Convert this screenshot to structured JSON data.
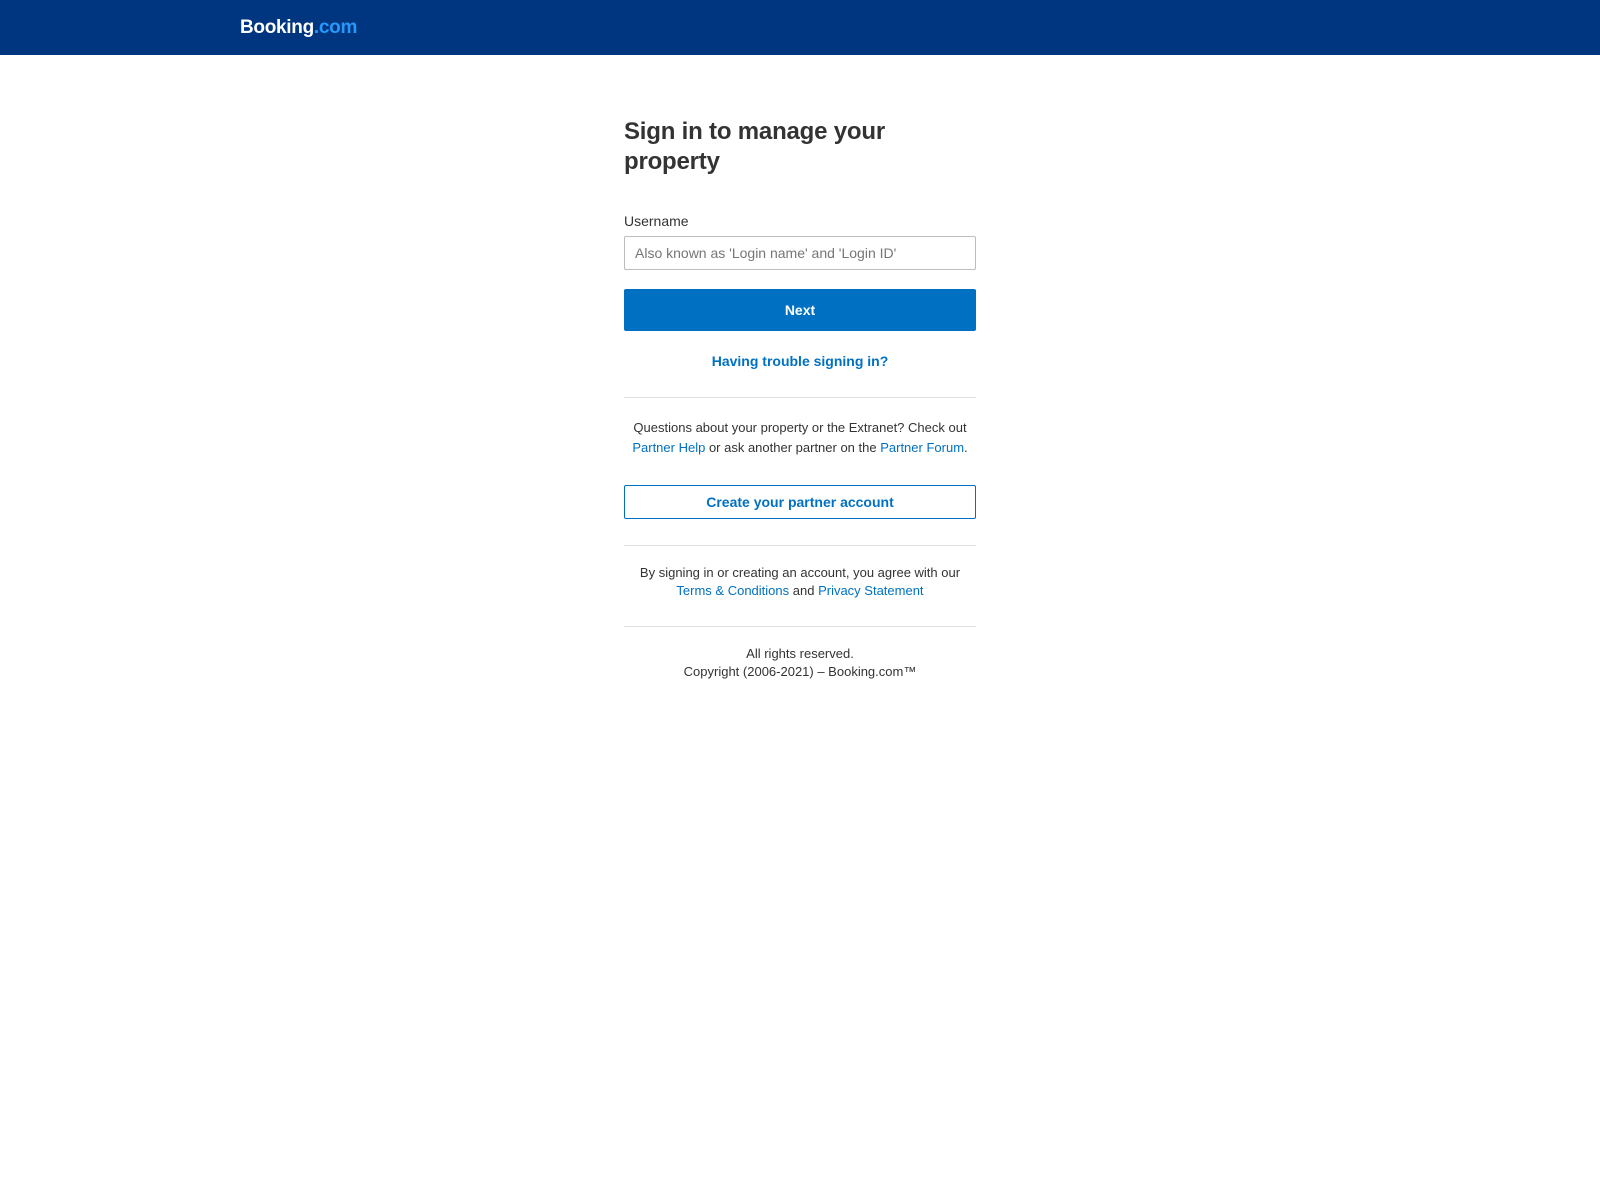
{
  "header": {
    "logo_main": "Booking",
    "logo_tld": ".com",
    "bg_color": "#003580",
    "tld_color": "#2699fb"
  },
  "main": {
    "title": "Sign in to manage your property",
    "username": {
      "label": "Username",
      "placeholder": "Also known as 'Login name' and 'Login ID'",
      "value": ""
    },
    "next_button": "Next",
    "trouble_link": "Having trouble signing in?",
    "info": {
      "part1": "Questions about your property or the Extranet? Check out ",
      "partner_help_link": "Partner Help",
      "part2": " or ask another partner on the ",
      "partner_forum_link": "Partner Forum",
      "part3": "."
    },
    "create_account_button": "Create your partner account",
    "legal": {
      "part1": "By signing in or creating an account, you agree with our ",
      "terms_link": "Terms & Conditions",
      "part2": " and ",
      "privacy_link": "Privacy Statement"
    },
    "footer": {
      "rights": "All rights reserved.",
      "copyright": "Copyright (2006-2021) – Booking.com™"
    }
  },
  "colors": {
    "primary": "#0071c2",
    "header": "#003580"
  }
}
